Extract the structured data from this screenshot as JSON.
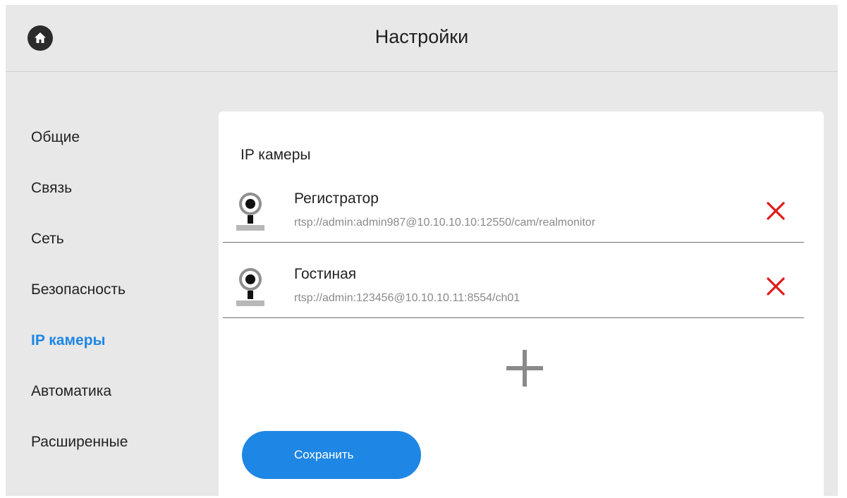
{
  "header": {
    "title": "Настройки",
    "home_icon": "home-icon"
  },
  "sidebar": {
    "items": [
      {
        "label": "Общие",
        "active": false
      },
      {
        "label": "Связь",
        "active": false
      },
      {
        "label": "Сеть",
        "active": false
      },
      {
        "label": "Безопасность",
        "active": false
      },
      {
        "label": "IP камеры",
        "active": true
      },
      {
        "label": "Автоматика",
        "active": false
      },
      {
        "label": "Расширенные",
        "active": false
      }
    ]
  },
  "main": {
    "title": "IP камеры",
    "cameras": [
      {
        "name": "Регистратор",
        "url": "rtsp://admin:admin987@10.10.10.10:12550/cam/realmonitor",
        "icon": "webcam-icon",
        "delete_icon": "close-icon"
      },
      {
        "name": "Гостиная",
        "url": "rtsp://admin:123456@10.10.10.11:8554/ch01",
        "icon": "webcam-icon",
        "delete_icon": "close-icon"
      }
    ],
    "add_icon": "plus-icon",
    "save_label": "Сохранить"
  },
  "colors": {
    "accent": "#1e86e4",
    "delete": "#e01b1b",
    "background": "#e8e8e8",
    "panel": "#ffffff"
  }
}
